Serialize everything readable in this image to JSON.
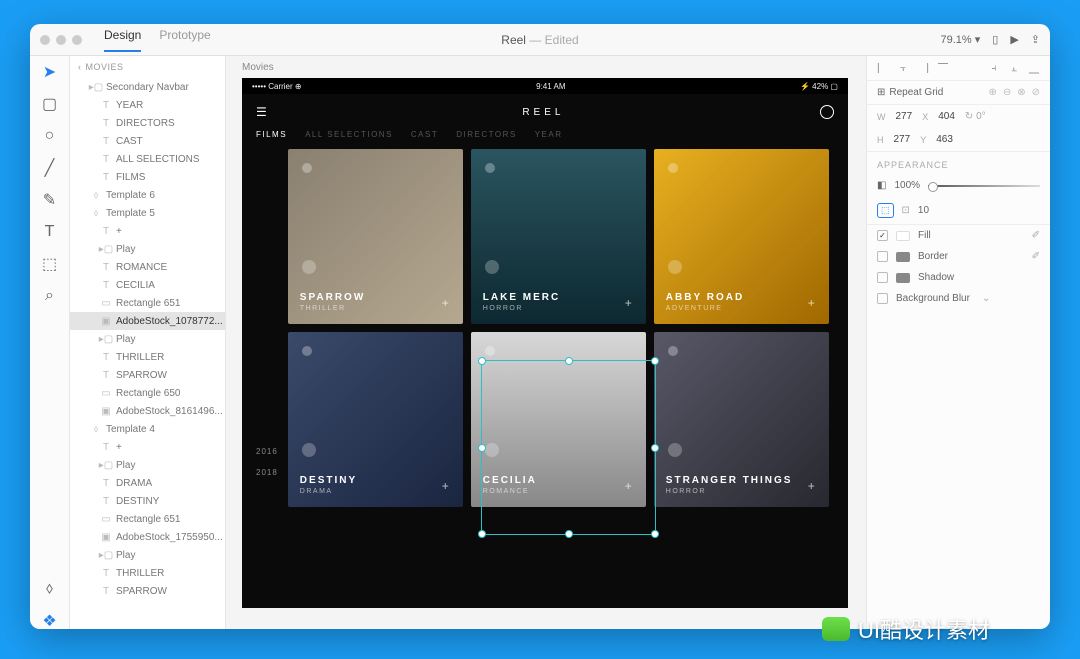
{
  "titlebar": {
    "tabs": [
      "Design",
      "Prototype"
    ],
    "doc": "Reel",
    "status": "Edited",
    "zoom": "79.1%"
  },
  "layers": {
    "head": "MOVIES",
    "items": [
      {
        "lvl": 1,
        "ic": "folder",
        "t": "Secondary Navbar"
      },
      {
        "lvl": 2,
        "ic": "T",
        "t": "YEAR"
      },
      {
        "lvl": 2,
        "ic": "T",
        "t": "DIRECTORS"
      },
      {
        "lvl": 2,
        "ic": "T",
        "t": "CAST"
      },
      {
        "lvl": 2,
        "ic": "T",
        "t": "ALL SELECTIONS"
      },
      {
        "lvl": 2,
        "ic": "T",
        "t": "FILMS"
      },
      {
        "lvl": 1,
        "ic": "comp",
        "t": "Template 6"
      },
      {
        "lvl": 1,
        "ic": "comp",
        "t": "Template 5"
      },
      {
        "lvl": 2,
        "ic": "T",
        "t": "+"
      },
      {
        "lvl": 2,
        "ic": "folder",
        "t": "Play"
      },
      {
        "lvl": 2,
        "ic": "T",
        "t": "ROMANCE"
      },
      {
        "lvl": 2,
        "ic": "T",
        "t": "CECILIA"
      },
      {
        "lvl": 2,
        "ic": "rect",
        "t": "Rectangle 651"
      },
      {
        "lvl": 2,
        "ic": "img",
        "t": "AdobeStock_1078772...",
        "sel": true
      },
      {
        "lvl": 2,
        "ic": "folder",
        "t": "Play"
      },
      {
        "lvl": 2,
        "ic": "T",
        "t": "THRILLER"
      },
      {
        "lvl": 2,
        "ic": "T",
        "t": "SPARROW"
      },
      {
        "lvl": 2,
        "ic": "rect",
        "t": "Rectangle 650"
      },
      {
        "lvl": 2,
        "ic": "img",
        "t": "AdobeStock_8161496..."
      },
      {
        "lvl": 1,
        "ic": "comp",
        "t": "Template 4"
      },
      {
        "lvl": 2,
        "ic": "T",
        "t": "+"
      },
      {
        "lvl": 2,
        "ic": "folder",
        "t": "Play"
      },
      {
        "lvl": 2,
        "ic": "T",
        "t": "DRAMA"
      },
      {
        "lvl": 2,
        "ic": "T",
        "t": "DESTINY"
      },
      {
        "lvl": 2,
        "ic": "rect",
        "t": "Rectangle 651"
      },
      {
        "lvl": 2,
        "ic": "img",
        "t": "AdobeStock_1755950..."
      },
      {
        "lvl": 2,
        "ic": "folder",
        "t": "Play"
      },
      {
        "lvl": 2,
        "ic": "T",
        "t": "THRILLER"
      },
      {
        "lvl": 2,
        "ic": "T",
        "t": "SPARROW"
      }
    ]
  },
  "canvas": {
    "artboard_label": "Movies",
    "status_left": "••••• Carrier ⊕",
    "status_time": "9:41 AM",
    "status_right": "⚡ 42% ▢",
    "brand": "REEL",
    "nav": [
      "FILMS",
      "ALL SELECTIONS",
      "CAST",
      "DIRECTORS",
      "YEAR"
    ],
    "years": [
      "2016",
      "2018"
    ],
    "cards": [
      {
        "title": "SPARROW",
        "sub": "THRILLER"
      },
      {
        "title": "LAKE MERC",
        "sub": "HORROR"
      },
      {
        "title": "ABBY ROAD",
        "sub": "ADVENTURE"
      },
      {
        "title": "DESTINY",
        "sub": "DRAMA"
      },
      {
        "title": "CECILIA",
        "sub": "ROMANCE"
      },
      {
        "title": "STRANGER THINGS",
        "sub": "HORROR"
      }
    ]
  },
  "inspector": {
    "repeat": "Repeat Grid",
    "w": "277",
    "x": "404",
    "h": "277",
    "y": "463",
    "rot": "0°",
    "appearance": "APPEARANCE",
    "opacity": "100%",
    "radius": "10",
    "fill": "Fill",
    "border": "Border",
    "shadow": "Shadow",
    "blur": "Background Blur"
  },
  "watermark": "UI酷设计素材"
}
